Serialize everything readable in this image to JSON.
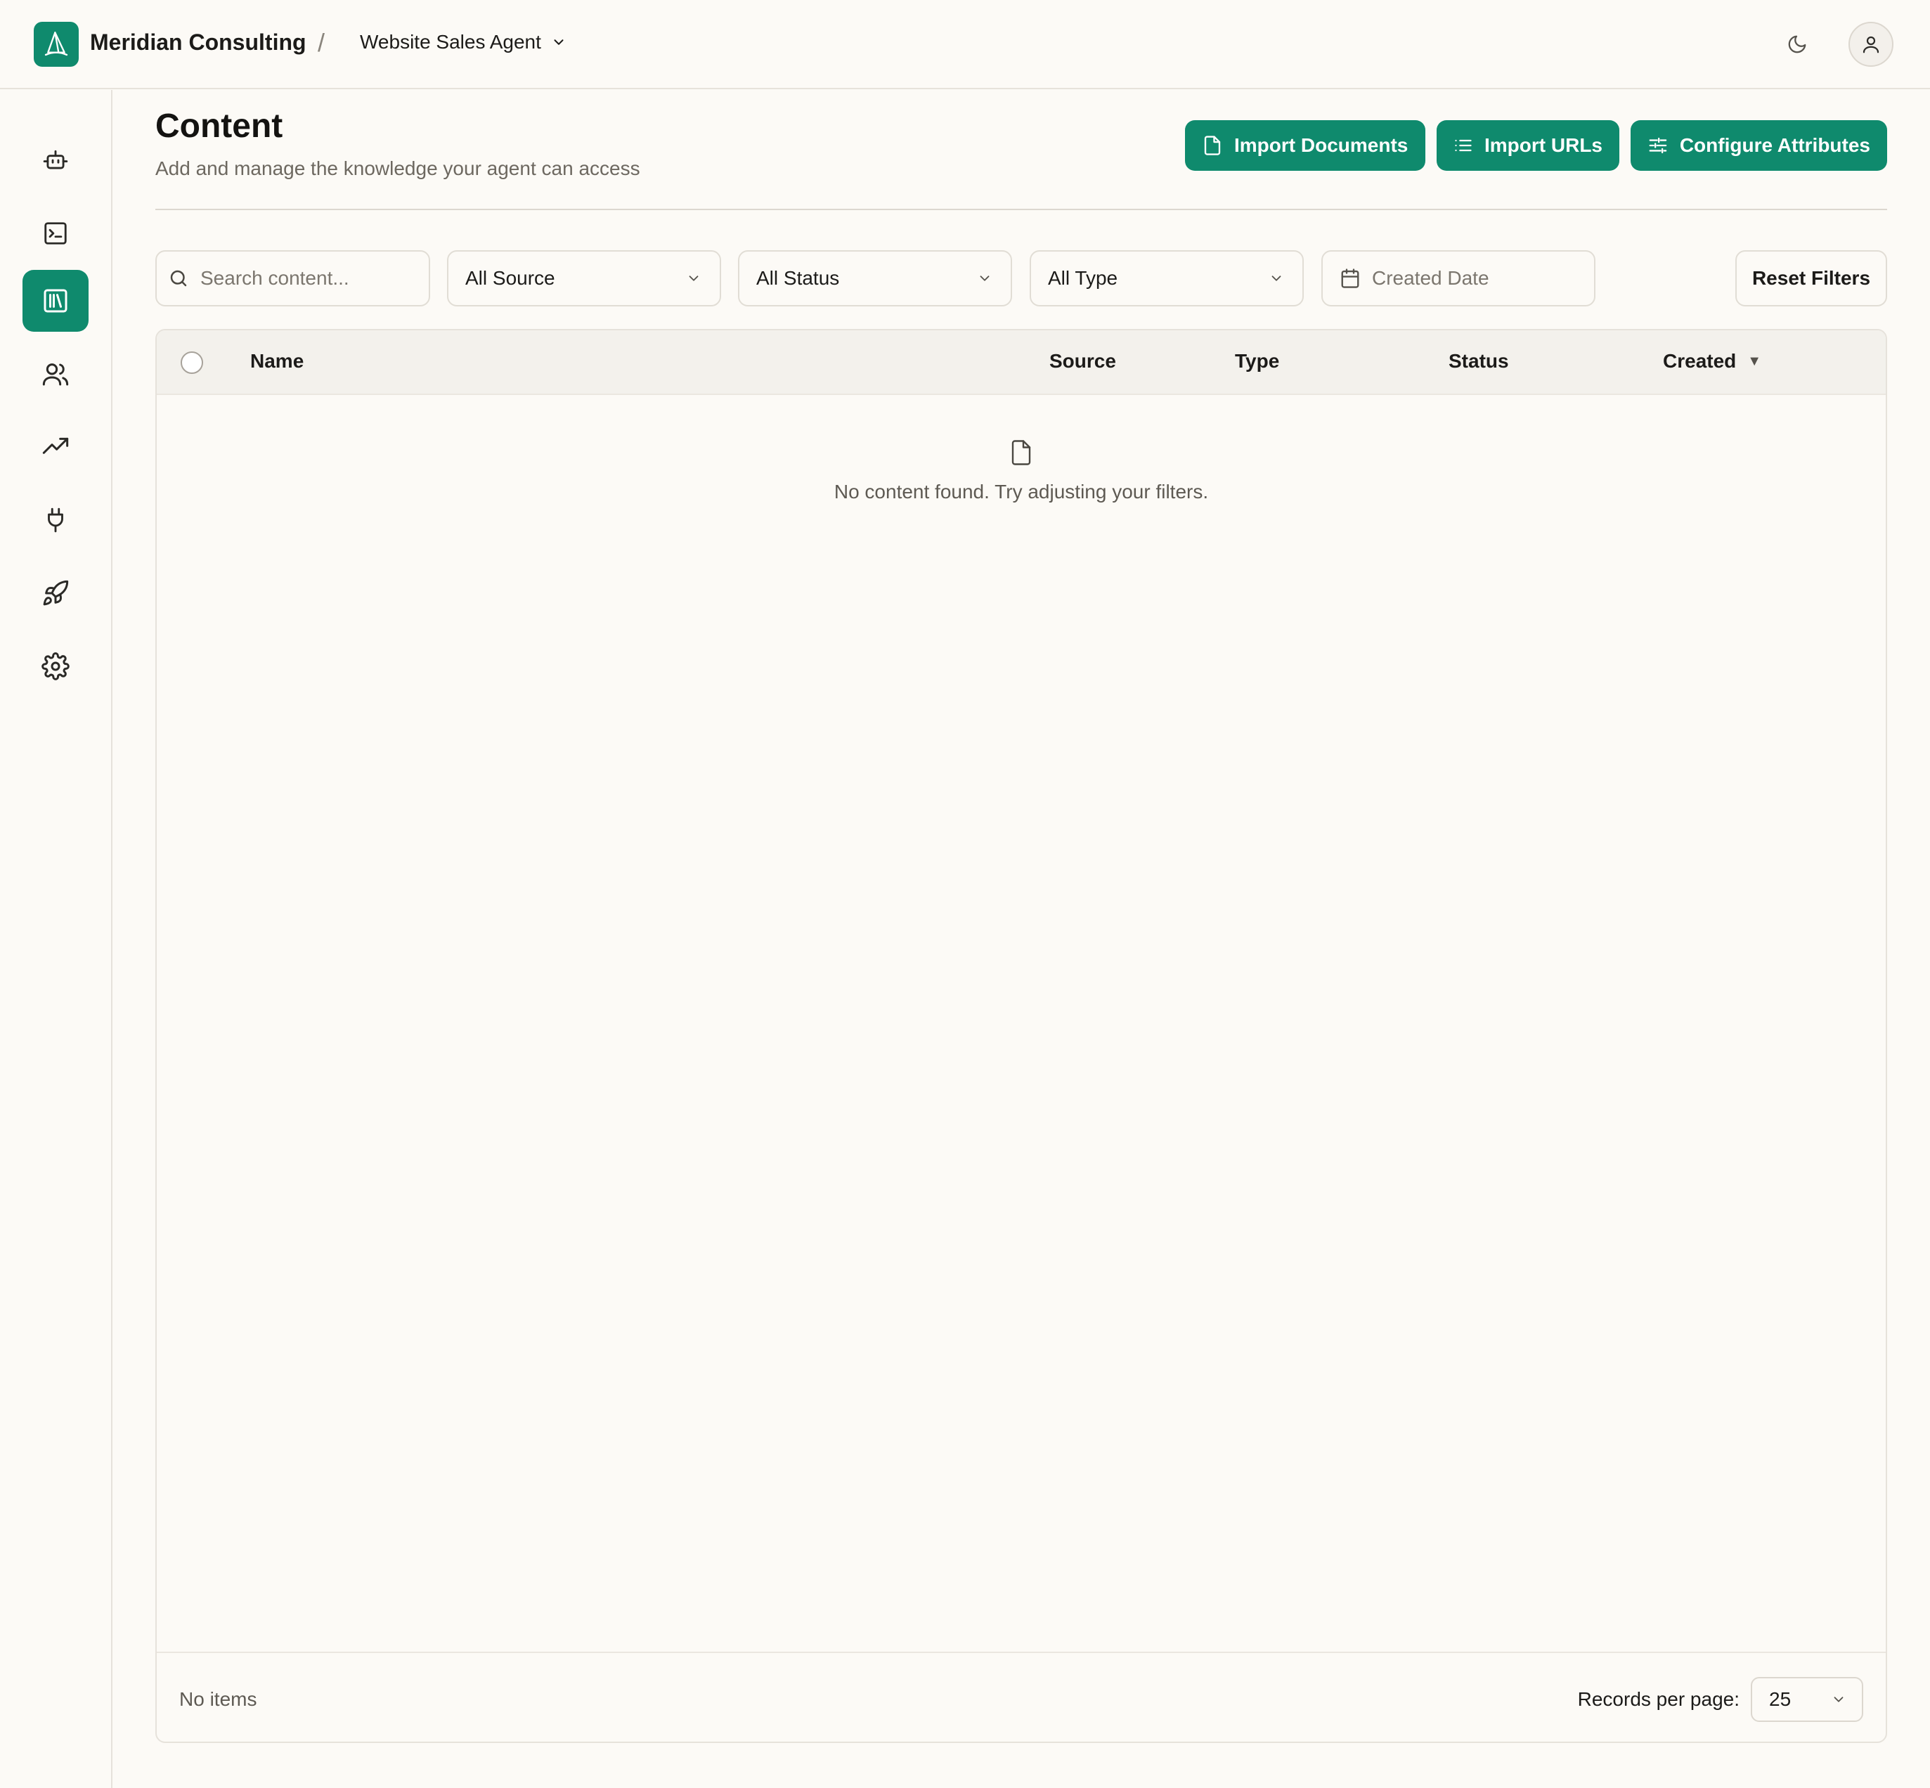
{
  "header": {
    "org_name": "Meridian Consulting",
    "separator": "/",
    "agent_name": "Website Sales Agent"
  },
  "sidebar": {
    "items": [
      {
        "icon": "bot-icon"
      },
      {
        "icon": "terminal-icon"
      },
      {
        "icon": "library-icon",
        "active": true
      },
      {
        "icon": "users-icon"
      },
      {
        "icon": "trending-up-icon"
      },
      {
        "icon": "plug-icon"
      },
      {
        "icon": "rocket-icon"
      },
      {
        "icon": "gear-icon"
      }
    ]
  },
  "page": {
    "title": "Content",
    "subtitle": "Add and manage the knowledge your agent can access"
  },
  "actions": {
    "import_documents": "Import Documents",
    "import_urls": "Import URLs",
    "configure_attributes": "Configure Attributes"
  },
  "filters": {
    "search_placeholder": "Search content...",
    "source": "All Source",
    "status": "All Status",
    "type": "All Type",
    "date_placeholder": "Created Date",
    "reset": "Reset Filters"
  },
  "table": {
    "columns": [
      "Name",
      "Source",
      "Type",
      "Status",
      "Created"
    ],
    "sort_indicator": "▼",
    "empty_message": "No content found. Try adjusting your filters.",
    "footer_count": "No items",
    "records_per_page_label": "Records per page:",
    "records_per_page": "25"
  },
  "colors": {
    "accent": "#0f8a6d",
    "background": "#fcfaf6",
    "border": "#e1ddd5"
  }
}
